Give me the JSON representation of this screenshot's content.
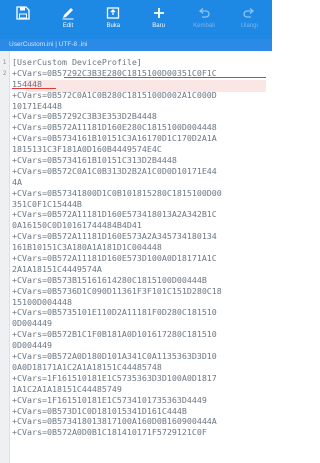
{
  "toolbar": {
    "items": [
      {
        "label": "",
        "icon": "save-icon",
        "enabled": true
      },
      {
        "label": "Edit",
        "icon": "edit-icon",
        "enabled": true
      },
      {
        "label": "Buka",
        "icon": "open-icon",
        "enabled": true
      },
      {
        "label": "Baru",
        "icon": "new-icon",
        "enabled": true
      },
      {
        "label": "Kembali",
        "icon": "undo-icon",
        "enabled": false
      },
      {
        "label": "Ulangi",
        "icon": "redo-icon",
        "enabled": false
      }
    ]
  },
  "file": {
    "info": "UserCustom.ini  |  UTF-8  .ini"
  },
  "editor": {
    "gutter": [
      "1",
      "2"
    ],
    "lines": [
      "[UserCustom DeviceProfile]",
      "+CVars=0B57292C3B3E280C1815100D00351C0F1C",
      "154448",
      "+CVars=0B572C0A1C0B280C1815100D002A1C000D",
      "10171E4448",
      "+CVars=0B57292C3B3E353D2B4448",
      "+CVars=0B572A11181D160E280C1815100D004448",
      "+CVars=0B5734161B10151C3A16170D1C170D2A1A",
      "1815131C3F181A0D160B4449574E4C",
      "+CVars=0B5734161B10151C313D2B4448",
      "+CVars=0B572C0A1C0B313D2B2A1C0D0D10171E44",
      "4A",
      "+CVars=0B57341800D1C0B101815280C1815100D00",
      "351C0F1C15444B",
      "+CVars=0B572A11181D160E573418013A2A342B1C",
      "0A16150C0D10161744484B4D41",
      "+CVars=0B572A11181D160E573A2A345734180134",
      "161B10151C3A180A1A181D1C004448",
      "+CVars=0B572A11181D160E573D100A0D18171A1C",
      "2A1A18151C4449574A",
      "+CVars=0B573B15161614280C1815100D00444B",
      "+CVars=0B5736D1C090D11361F3F101C151D280C18",
      "15100D004448",
      "+CVars=0B5735101E110D2A11181F0D280C181510",
      "0D004449",
      "+CVars=0B572B1C1F0B181A0D101617280C181510",
      "0D004449",
      "+CVars=0B572A0D180D101A341C0A1135363D3D10",
      "0A0D18171A1C2A1A18151C44485748",
      "+CVars=1F161510181E1C5735363D3D100A0D1817",
      "1A1C2A1A18151C44485749",
      "+CVars=1F161510181E1C5734101735363D4449",
      "+CVars=0B573D1C0D181015341D161C444B",
      "+CVars=0B573418013817100A160D0B160900444A",
      "+CVars=0B572A0D0B1C181410171F5729121C0F"
    ]
  },
  "colors": {
    "toolbar": "#1e88e5",
    "highlight_underline": "#e53935",
    "text": "#6a7784"
  }
}
